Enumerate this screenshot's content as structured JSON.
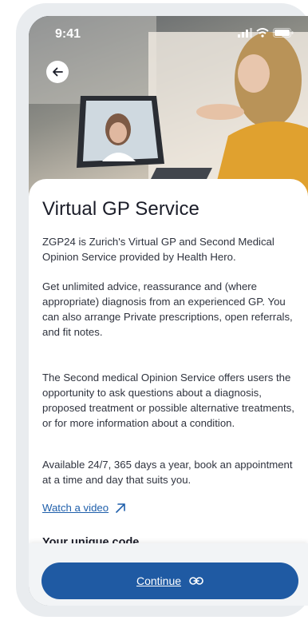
{
  "status": {
    "time": "9:41"
  },
  "page": {
    "title": "Virtual GP Service",
    "paragraphs": [
      "ZGP24 is Zurich's Virtual GP and Second Medical Opinion Service provided by Health Hero.",
      "Get unlimited advice, reassurance and (where appropriate) diagnosis from an experienced GP. You can also arrange Private prescriptions, open referrals, and fit notes.",
      "The Second medical Opinion Service offers users the opportunity to ask questions about a diagnosis, proposed treatment or possible alternative treatments, or for more information about a condition.",
      "Available 24/7, 365 days a year, book an appointment at a time and day that suits you."
    ],
    "video_link": "Watch a video",
    "code_label": "Your unique code"
  },
  "actions": {
    "continue_label": "Continue"
  },
  "colors": {
    "primary": "#1f5aa3",
    "link": "#1f5fab"
  }
}
